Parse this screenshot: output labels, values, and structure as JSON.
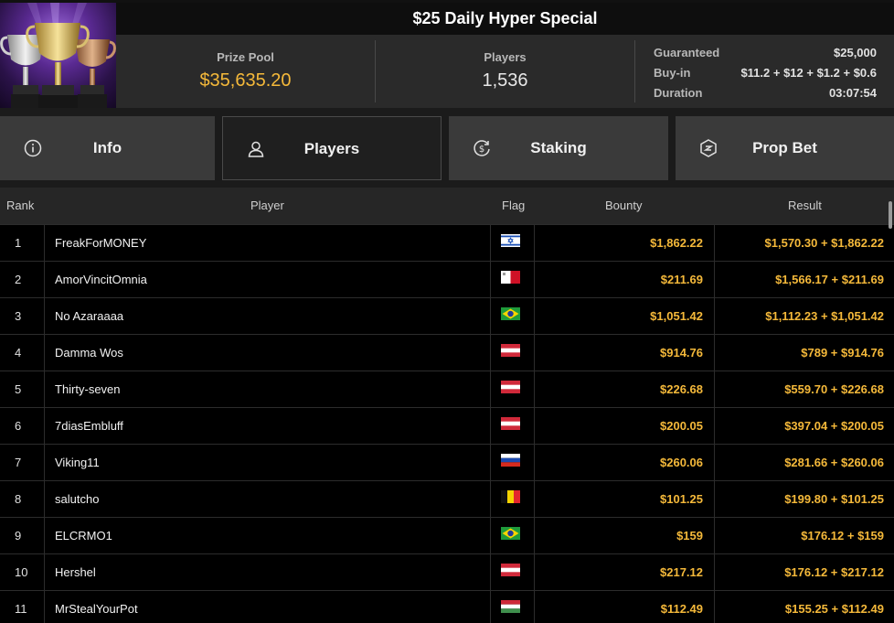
{
  "header": {
    "title": "$25 Daily Hyper Special",
    "prize_pool_label": "Prize Pool",
    "prize_pool_value": "$35,635.20",
    "players_label": "Players",
    "players_value": "1,536",
    "details": [
      {
        "label": "Guaranteed",
        "value": "$25,000"
      },
      {
        "label": "Buy-in",
        "value": "$11.2 + $12 + $1.2 + $0.6"
      },
      {
        "label": "Duration",
        "value": "03:07:54"
      }
    ]
  },
  "tabs": [
    {
      "label": "Info",
      "icon": "info-circle-icon"
    },
    {
      "label": "Players",
      "icon": "user-icon",
      "active": true
    },
    {
      "label": "Staking",
      "icon": "dollar-cycle-icon"
    },
    {
      "label": "Prop Bet",
      "icon": "prop-bet-icon"
    }
  ],
  "table": {
    "columns": [
      "Rank",
      "Player",
      "Flag",
      "Bounty",
      "Result"
    ],
    "rows": [
      {
        "rank": "1",
        "player": "FreakForMONEY",
        "flag": "israel",
        "bounty": "$1,862.22",
        "result": "$1,570.30 + $1,862.22"
      },
      {
        "rank": "2",
        "player": "AmorVincitOmnia",
        "flag": "malta",
        "bounty": "$211.69",
        "result": "$1,566.17 + $211.69"
      },
      {
        "rank": "3",
        "player": "No Azaraaaa",
        "flag": "brazil",
        "bounty": "$1,051.42",
        "result": "$1,112.23 + $1,051.42"
      },
      {
        "rank": "4",
        "player": "Damma Wos",
        "flag": "austria",
        "bounty": "$914.76",
        "result": "$789 + $914.76"
      },
      {
        "rank": "5",
        "player": "Thirty-seven",
        "flag": "austria",
        "bounty": "$226.68",
        "result": "$559.70 + $226.68"
      },
      {
        "rank": "6",
        "player": "7diasEmbluff",
        "flag": "austria",
        "bounty": "$200.05",
        "result": "$397.04 + $200.05"
      },
      {
        "rank": "7",
        "player": "Viking11",
        "flag": "russia",
        "bounty": "$260.06",
        "result": "$281.66 + $260.06"
      },
      {
        "rank": "8",
        "player": "salutcho",
        "flag": "belgium",
        "bounty": "$101.25",
        "result": "$199.80 + $101.25"
      },
      {
        "rank": "9",
        "player": "ELCRMO1",
        "flag": "brazil",
        "bounty": "$159",
        "result": "$176.12 + $159"
      },
      {
        "rank": "10",
        "player": "Hershel",
        "flag": "austria",
        "bounty": "$217.12",
        "result": "$176.12 + $217.12"
      },
      {
        "rank": "11",
        "player": "MrStealYourPot",
        "flag": "hungary",
        "bounty": "$112.49",
        "result": "$155.25 + $112.49"
      }
    ]
  },
  "colors": {
    "accent": "#f5b93a",
    "background": "#000000",
    "tab": "#3a3a3a"
  }
}
